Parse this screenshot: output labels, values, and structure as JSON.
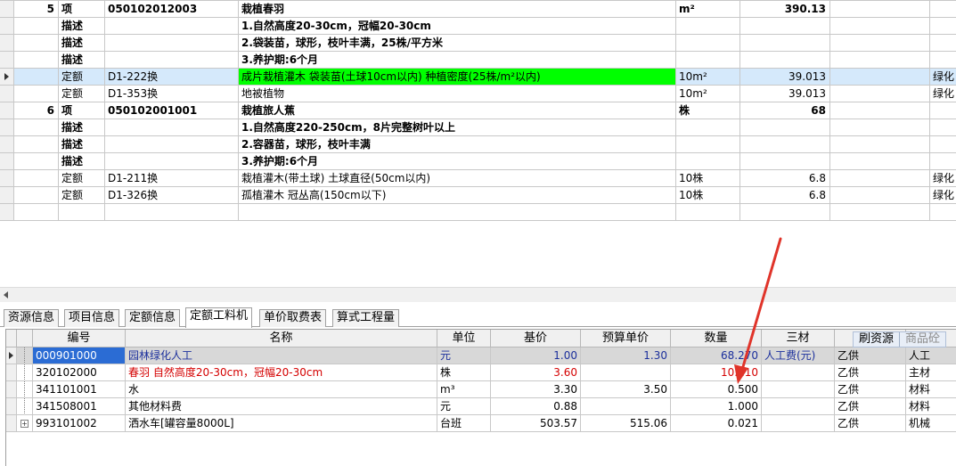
{
  "top_rows": [
    {
      "no": "5",
      "type": "项",
      "code": "050102012003",
      "name": "栽植春羽",
      "unit": "m²",
      "qty": "390.13",
      "extra": "",
      "kind": "item"
    },
    {
      "no": "",
      "type": "描述",
      "code": "",
      "name": "1.自然高度20-30cm，冠幅20-30cm",
      "unit": "",
      "qty": "",
      "extra": "",
      "kind": "desc"
    },
    {
      "no": "",
      "type": "描述",
      "code": "",
      "name": "2.袋装苗，球形，枝叶丰满，25株/平方米",
      "unit": "",
      "qty": "",
      "extra": "",
      "kind": "desc"
    },
    {
      "no": "",
      "type": "描述",
      "code": "",
      "name": "3.养护期:6个月",
      "unit": "",
      "qty": "",
      "extra": "",
      "kind": "desc"
    },
    {
      "no": "",
      "type": "定额",
      "code": "D1-222换",
      "name": "成片栽植灌木 袋装苗(土球10cm以内) 种植密度(25株/m²以内)",
      "unit": "10m²",
      "qty": "39.013",
      "extra": "绿化",
      "kind": "quota-selected"
    },
    {
      "no": "",
      "type": "定额",
      "code": "D1-353换",
      "name": "地被植物",
      "unit": "10m²",
      "qty": "39.013",
      "extra": "绿化",
      "kind": "quota"
    },
    {
      "no": "6",
      "type": "项",
      "code": "050102001001",
      "name": "栽植旅人蕉",
      "unit": "株",
      "qty": "68",
      "extra": "",
      "kind": "item"
    },
    {
      "no": "",
      "type": "描述",
      "code": "",
      "name": "1.自然高度220-250cm，8片完整树叶以上",
      "unit": "",
      "qty": "",
      "extra": "",
      "kind": "desc"
    },
    {
      "no": "",
      "type": "描述",
      "code": "",
      "name": "2.容器苗，球形，枝叶丰满",
      "unit": "",
      "qty": "",
      "extra": "",
      "kind": "desc"
    },
    {
      "no": "",
      "type": "描述",
      "code": "",
      "name": "3.养护期:6个月",
      "unit": "",
      "qty": "",
      "extra": "",
      "kind": "desc"
    },
    {
      "no": "",
      "type": "定额",
      "code": "D1-211换",
      "name": "栽植灌木(带土球) 土球直径(50cm以内)",
      "unit": "10株",
      "qty": "6.8",
      "extra": "绿化",
      "kind": "quota"
    },
    {
      "no": "",
      "type": "定额",
      "code": "D1-326换",
      "name": "孤植灌木 冠丛高(150cm以下)",
      "unit": "10株",
      "qty": "6.8",
      "extra": "绿化",
      "kind": "quota"
    }
  ],
  "tabs": [
    "资源信息",
    "项目信息",
    "定额信息",
    "定额工料机",
    "单价取费表",
    "算式工程量"
  ],
  "active_tab": 3,
  "bottom_headers": [
    "编号",
    "名称",
    "单位",
    "基价",
    "预算单价",
    "数量",
    "三材",
    "",
    ""
  ],
  "buttons": {
    "refresh": "刷资源",
    "goods": "商品砼"
  },
  "bottom_rows": [
    {
      "code": "000901000",
      "name": "园林绿化人工",
      "unit": "元",
      "base": "1.00",
      "budget": "1.30",
      "qty": "68.270",
      "mat": "人工费(元)",
      "supply": "乙供",
      "cat": "人工",
      "style": "highlight"
    },
    {
      "code": "320102000",
      "name": "春羽 自然高度20-30cm，冠幅20-30cm",
      "unit": "株",
      "base": "3.60",
      "budget": "",
      "qty": "10.210",
      "mat": "",
      "supply": "乙供",
      "cat": "主材",
      "style": "red"
    },
    {
      "code": "341101001",
      "name": "水",
      "unit": "m³",
      "base": "3.30",
      "budget": "3.50",
      "qty": "0.500",
      "mat": "",
      "supply": "乙供",
      "cat": "材料",
      "style": "normal"
    },
    {
      "code": "341508001",
      "name": "其他材料费",
      "unit": "元",
      "base": "0.88",
      "budget": "",
      "qty": "1.000",
      "mat": "",
      "supply": "乙供",
      "cat": "材料",
      "style": "normal"
    },
    {
      "code": "993101002",
      "name": "洒水车[罐容量8000L]",
      "unit": "台班",
      "base": "503.57",
      "budget": "515.06",
      "qty": "0.021",
      "mat": "",
      "supply": "乙供",
      "cat": "机械",
      "style": "expand"
    }
  ],
  "colors": {
    "selected_row": "#d5e9fb",
    "green_highlight": "#00ff00",
    "red_text": "#d40000",
    "blue_text": "#1b2f9c",
    "arrow": "#e0342a"
  }
}
